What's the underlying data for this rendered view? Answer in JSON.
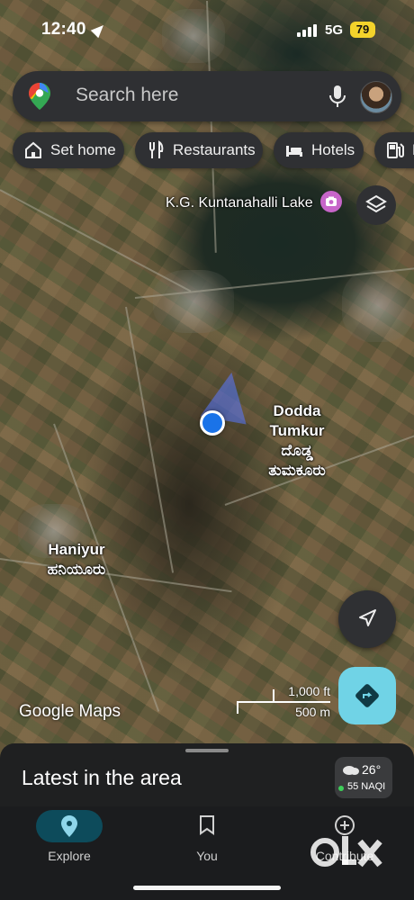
{
  "status_bar": {
    "time": "12:40",
    "network": "5G",
    "battery": "79"
  },
  "search": {
    "placeholder": "Search here"
  },
  "chips": [
    {
      "label": "Set home",
      "icon": "home-icon"
    },
    {
      "label": "Restaurants",
      "icon": "fork-knife-icon"
    },
    {
      "label": "Hotels",
      "icon": "bed-icon"
    },
    {
      "label": "P",
      "icon": "gas-station-icon"
    }
  ],
  "map": {
    "lake_label": "K.G. Kuntanahalli Lake",
    "places": [
      {
        "name": "Dodda",
        "name2": "Tumkur",
        "local1": "ದೊಡ್ಡ",
        "local2": "ತುಮಕೂರು"
      },
      {
        "name": "Haniyur",
        "local": "ಹನಿಯೂರು"
      }
    ],
    "scale": {
      "imperial": "1,000 ft",
      "metric": "500 m"
    },
    "attribution": "Google Maps"
  },
  "sheet": {
    "title": "Latest in the area"
  },
  "weather": {
    "temperature": "26°",
    "aqi": "55 NAQI"
  },
  "nav": [
    {
      "label": "Explore",
      "icon": "explore-pin-icon"
    },
    {
      "label": "You",
      "icon": "bookmark-icon"
    },
    {
      "label": "Contribute",
      "icon": "plus-circle-icon"
    }
  ],
  "watermark": "OLX",
  "colors": {
    "accent": "#70d3e6",
    "location": "#1a73e8",
    "chip_bg": "#2f3033"
  }
}
